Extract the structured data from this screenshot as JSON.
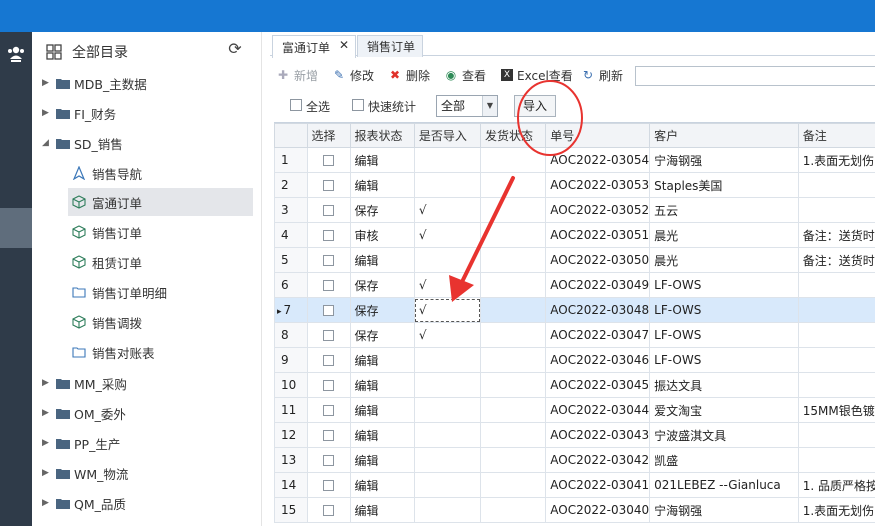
{
  "sidebar": {
    "title": "全部目录",
    "groups": [
      {
        "label": "MDB_主数据"
      },
      {
        "label": "FI_财务"
      },
      {
        "label": "SD_销售"
      },
      {
        "label": "MM_采购"
      },
      {
        "label": "OM_委外"
      },
      {
        "label": "PP_生产"
      },
      {
        "label": "WM_物流"
      },
      {
        "label": "QM_品质"
      }
    ],
    "sd_items": [
      {
        "label": "销售导航",
        "icon": "navigation-icon"
      },
      {
        "label": "富通订单",
        "icon": "cube-icon"
      },
      {
        "label": "销售订单",
        "icon": "cube-icon"
      },
      {
        "label": "租赁订单",
        "icon": "cube-icon"
      },
      {
        "label": "销售订单明细",
        "icon": "folder-icon"
      },
      {
        "label": "销售调拨",
        "icon": "cube-icon"
      },
      {
        "label": "销售对账表",
        "icon": "folder-icon"
      }
    ]
  },
  "tabs": [
    {
      "label": "富通订单",
      "active": true
    },
    {
      "label": "销售订单",
      "active": false
    }
  ],
  "toolbar": {
    "add": "新增",
    "edit": "修改",
    "delete": "删除",
    "view": "查看",
    "excel_view": "Excel查看",
    "refresh": "刷新"
  },
  "filter": {
    "select_all": "全选",
    "quick_stats": "快速统计",
    "status_select": "全部",
    "import": "导入"
  },
  "table": {
    "columns": [
      "选择",
      "报表状态",
      "是否导入",
      "发货状态",
      "单号",
      "客户",
      "备注"
    ],
    "rows": [
      {
        "n": "1",
        "status": "编辑",
        "imported": "",
        "ship": "",
        "no": "AOC2022-03054",
        "customer": "宁海钢强",
        "note": "1.表面无划伤"
      },
      {
        "n": "2",
        "status": "编辑",
        "imported": "",
        "ship": "",
        "no": "AOC2022-03053",
        "customer": "Staples美国",
        "note": ""
      },
      {
        "n": "3",
        "status": "保存",
        "imported": "√",
        "ship": "",
        "no": "AOC2022-03052",
        "customer": "五云",
        "note": ""
      },
      {
        "n": "4",
        "status": "审核",
        "imported": "√",
        "ship": "",
        "no": "AOC2022-03051",
        "customer": "晨光",
        "note": "备注：送货时"
      },
      {
        "n": "5",
        "status": "编辑",
        "imported": "",
        "ship": "",
        "no": "AOC2022-03050",
        "customer": "晨光",
        "note": "备注：送货时"
      },
      {
        "n": "6",
        "status": "保存",
        "imported": "√",
        "ship": "",
        "no": "AOC2022-03049",
        "customer": "LF-OWS",
        "note": ""
      },
      {
        "n": "7",
        "status": "保存",
        "imported": "√",
        "ship": "",
        "no": "AOC2022-03048",
        "customer": "LF-OWS",
        "note": ""
      },
      {
        "n": "8",
        "status": "保存",
        "imported": "√",
        "ship": "",
        "no": "AOC2022-03047",
        "customer": "LF-OWS",
        "note": ""
      },
      {
        "n": "9",
        "status": "编辑",
        "imported": "",
        "ship": "",
        "no": "AOC2022-03046",
        "customer": "LF-OWS",
        "note": ""
      },
      {
        "n": "10",
        "status": "编辑",
        "imported": "",
        "ship": "",
        "no": "AOC2022-03045",
        "customer": "振达文具",
        "note": ""
      },
      {
        "n": "11",
        "status": "编辑",
        "imported": "",
        "ship": "",
        "no": "AOC2022-03044",
        "customer": "爱文淘宝",
        "note": "15MM银色镀"
      },
      {
        "n": "12",
        "status": "编辑",
        "imported": "",
        "ship": "",
        "no": "AOC2022-03043",
        "customer": "宁波盛淇文具",
        "note": ""
      },
      {
        "n": "13",
        "status": "编辑",
        "imported": "",
        "ship": "",
        "no": "AOC2022-03042",
        "customer": "凯盛",
        "note": ""
      },
      {
        "n": "14",
        "status": "编辑",
        "imported": "",
        "ship": "",
        "no": "AOC2022-03041",
        "customer": "021LEBEZ --Gianluca",
        "note": "1. 品质严格按"
      },
      {
        "n": "15",
        "status": "编辑",
        "imported": "",
        "ship": "",
        "no": "AOC2022-03040",
        "customer": "宁海钢强",
        "note": "1.表面无划伤"
      }
    ],
    "selected_row": "7"
  },
  "colors": {
    "topbar": "#1677d2",
    "rail": "#2f3b49",
    "selected_row": "#d8e9fb",
    "annotation": "#e8332f"
  }
}
